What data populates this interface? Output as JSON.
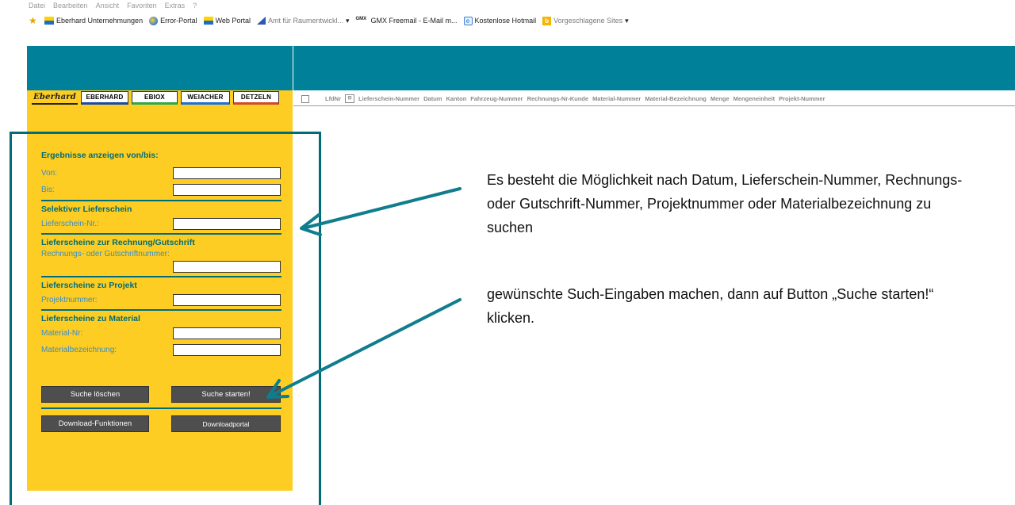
{
  "browser": {
    "menu": [
      "Datei",
      "Bearbeiten",
      "Ansicht",
      "Favoriten",
      "Extras",
      "?"
    ],
    "favorites": [
      {
        "label": "Eberhard Unternehmungen",
        "icon": "flag-icon"
      },
      {
        "label": "Error-Portal",
        "icon": "globe-icon"
      },
      {
        "label": "Web Portal",
        "icon": "flag-icon"
      },
      {
        "label": "Amt für Raumentwickl...",
        "icon": "triangle-icon"
      },
      {
        "label": "GMX Freemail - E-Mail m...",
        "icon": "gmx-icon"
      },
      {
        "label": "Kostenlose Hotmail",
        "icon": "ie-icon"
      },
      {
        "label": "Vorgeschlagene Sites",
        "icon": "bing-icon"
      }
    ],
    "gmx_glyph": "GMX",
    "ie_glyph": "e",
    "bing_glyph": "b",
    "dropdown_glyph": "▾",
    "star_glyph": "★"
  },
  "brands": {
    "logo": "Eberhard",
    "tabs": [
      "EBERHARD",
      "EBIOX",
      "WEIACHER",
      "DETZELN"
    ]
  },
  "table": {
    "columns_before_icon": [
      "LfdNr"
    ],
    "icon_glyph": "⊟",
    "columns": [
      "Lieferschein-Nummer",
      "Datum",
      "Kanton",
      "Fahrzeug-Nummer",
      "Rechnungs-Nr-Kunde",
      "Material-Nummer",
      "Material-Bezeichnung",
      "Menge",
      "Mengeneinheit",
      "Projekt-Nummer"
    ]
  },
  "form": {
    "results_title": "Ergebnisse anzeigen von/bis:",
    "from_label": "Von:",
    "to_label": "Bis:",
    "selective_title": "Selektiver Lieferschein",
    "delivery_label": "Lieferschein-Nr.:",
    "invoice_title": "Lieferscheine zur Rechnung/Gutschrift",
    "invoice_label": "Rechnungs- oder Gutschriftnummer:",
    "project_title": "Lieferscheine zu Projekt",
    "project_label": "Projektnummer:",
    "material_title": "Lieferscheine zu Material",
    "material_nr_label": "Material-Nr:",
    "material_desc_label": "Materialbezeichnung:",
    "clear_button": "Suche löschen",
    "start_button": "Suche starten!",
    "download_functions_button": "Download-Funktionen",
    "download_portal_button": "Downloadportal",
    "values": {
      "from": "",
      "to": "",
      "delivery": "",
      "invoice": "",
      "project": "",
      "material_nr": "",
      "material_desc": ""
    }
  },
  "annotations": {
    "note1": "Es besteht die Möglichkeit nach Datum, Lieferschein-Nummer, Rechnungs- oder Gutschrift-Nummer, Projektnummer oder Materialbezeichnung zu suchen",
    "note2": "gewünschte Such-Eingaben machen,  dann auf Button „Suche starten!“ klicken."
  },
  "colors": {
    "teal": "#008199",
    "teal_dark": "#006c78",
    "sidebar_yellow": "#fdcd23",
    "button_gray": "#4e4e4e",
    "label_blue": "#3a8cc8"
  }
}
